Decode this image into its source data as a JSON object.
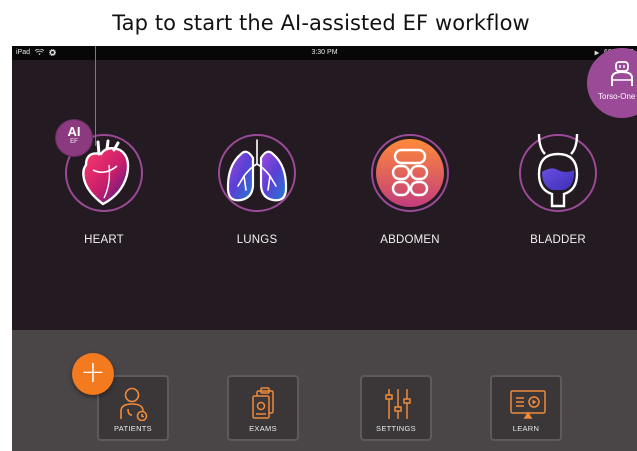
{
  "caption": "Tap to start the AI-assisted EF workflow",
  "status_bar": {
    "device": "iPad",
    "time": "3:30 PM",
    "battery": "60%"
  },
  "preset": {
    "label": "Torso-One"
  },
  "ef_badge": {
    "main": "AI",
    "sub": "EF"
  },
  "organs": [
    {
      "label": "HEART",
      "icon": "heart-icon"
    },
    {
      "label": "LUNGS",
      "icon": "lungs-icon"
    },
    {
      "label": "ABDOMEN",
      "icon": "abdomen-icon"
    },
    {
      "label": "BLADDER",
      "icon": "bladder-icon"
    }
  ],
  "fab": {
    "label": "+"
  },
  "nav": [
    {
      "label": "PATIENTS",
      "icon": "patient-icon"
    },
    {
      "label": "EXAMS",
      "icon": "exams-icon"
    },
    {
      "label": "SETTINGS",
      "icon": "settings-sliders-icon"
    },
    {
      "label": "LEARN",
      "icon": "learn-video-icon"
    }
  ],
  "colors": {
    "accent_orange": "#f47a20",
    "accent_purple": "#9b4a97",
    "background": "#231b21",
    "nav_bar": "#4a4546",
    "callout_line": "#1aa3b8"
  }
}
